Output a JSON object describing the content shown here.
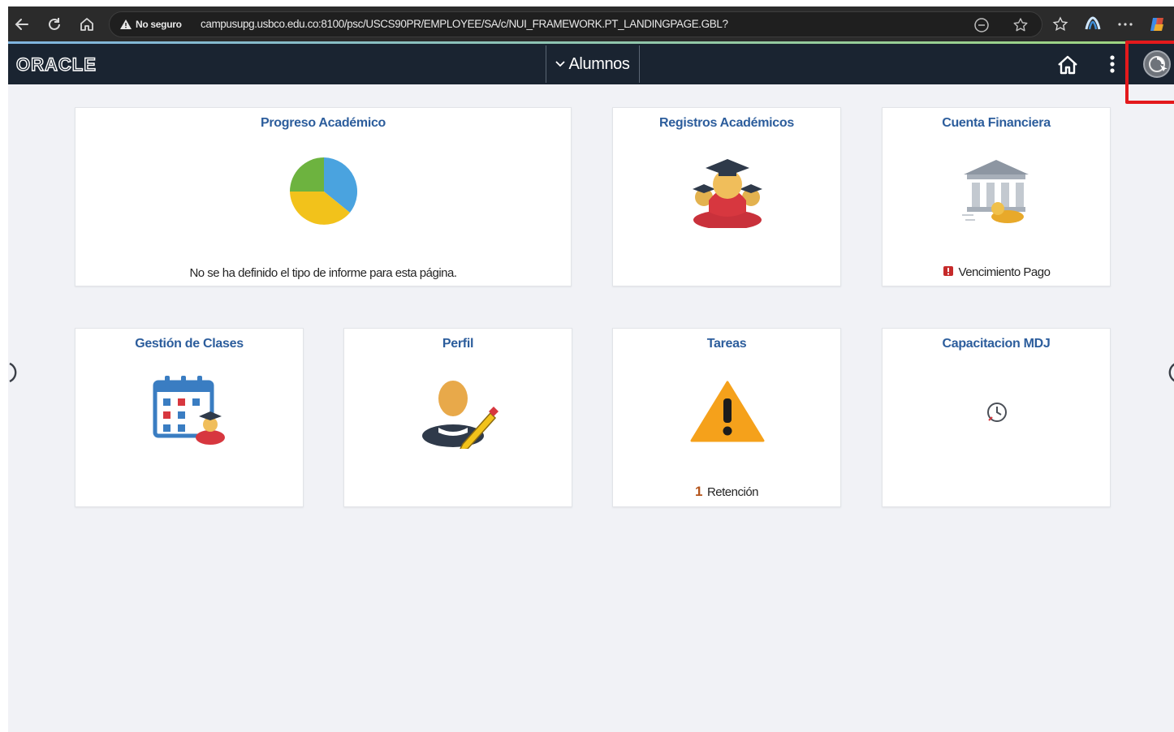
{
  "browser": {
    "security_label": "No seguro",
    "url": "campusupg.usbco.edu.co:8100/psc/USCS90PR/EMPLOYEE/SA/c/NUI_FRAMEWORK.PT_LANDINGPAGE.GBL?"
  },
  "header": {
    "logo": "ORACLE",
    "homepage_selector": "Alumnos"
  },
  "tiles": [
    {
      "title": "Progreso Académico",
      "footer": "No se ha definido el tipo de informe para esta página."
    },
    {
      "title": "Registros Académicos"
    },
    {
      "title": "Cuenta Financiera",
      "footer": "Vencimiento Pago"
    },
    {
      "title": "Gestión de Clases"
    },
    {
      "title": "Perfil"
    },
    {
      "title": "Tareas",
      "count": "1",
      "footer": "Retención"
    },
    {
      "title": "Capacitacion MDJ"
    }
  ],
  "colors": {
    "header_bg": "#1a2431",
    "tile_title": "#2c5d9c",
    "highlight": "#e3191c"
  }
}
